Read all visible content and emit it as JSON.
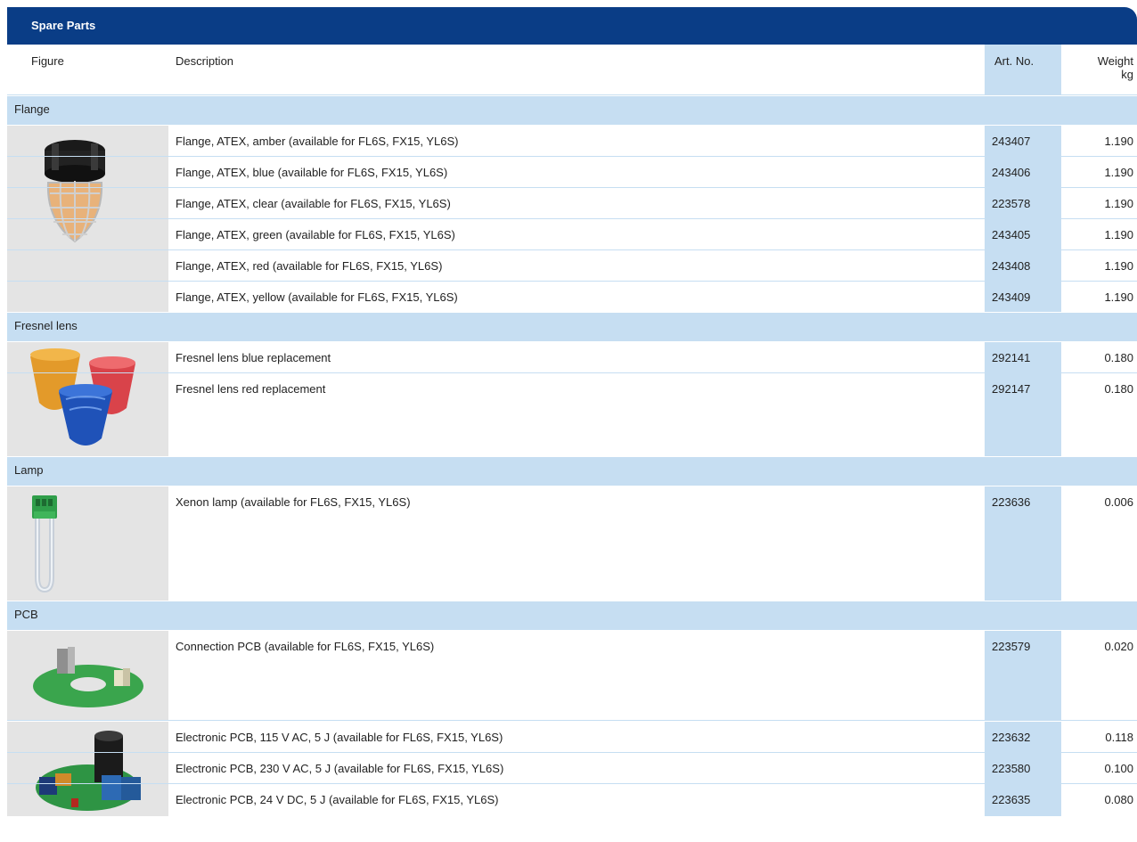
{
  "title": "Spare Parts",
  "headers": {
    "figure": "Figure",
    "description": "Description",
    "art_no": "Art. No.",
    "weight_line1": "Weight",
    "weight_line2": "kg"
  },
  "colors": {
    "header_bar": "#0a3d86",
    "light_blue": "#c6def2",
    "figure_bg": "#e4e4e4"
  },
  "sections": [
    {
      "name": "Flange",
      "groups": [
        {
          "icon": "flange-icon",
          "rows": [
            {
              "description": "Flange, ATEX, amber (available for FL6S, FX15, YL6S)",
              "art_no": "243407",
              "weight": "1.190"
            },
            {
              "description": "Flange, ATEX, blue (available for FL6S, FX15, YL6S)",
              "art_no": "243406",
              "weight": "1.190"
            },
            {
              "description": "Flange, ATEX, clear (available for FL6S, FX15, YL6S)",
              "art_no": "223578",
              "weight": "1.190"
            },
            {
              "description": "Flange, ATEX, green (available for FL6S, FX15, YL6S)",
              "art_no": "243405",
              "weight": "1.190"
            },
            {
              "description": "Flange, ATEX, red (available for FL6S, FX15, YL6S)",
              "art_no": "243408",
              "weight": "1.190"
            },
            {
              "description": "Flange, ATEX, yellow (available for FL6S, FX15, YL6S)",
              "art_no": "243409",
              "weight": "1.190"
            }
          ]
        }
      ]
    },
    {
      "name": "Fresnel lens",
      "groups": [
        {
          "icon": "fresnel-lens-icon",
          "rows": [
            {
              "description": "Fresnel lens blue replacement",
              "art_no": "292141",
              "weight": "0.180"
            },
            {
              "description": "Fresnel lens red replacement",
              "art_no": "292147",
              "weight": "0.180"
            }
          ]
        }
      ]
    },
    {
      "name": "Lamp",
      "groups": [
        {
          "icon": "xenon-lamp-icon",
          "rows": [
            {
              "description": "Xenon lamp (available for FL6S, FX15, YL6S)",
              "art_no": "223636",
              "weight": "0.006"
            }
          ]
        }
      ]
    },
    {
      "name": "PCB",
      "groups": [
        {
          "icon": "connection-pcb-icon",
          "rows": [
            {
              "description": "Connection PCB (available for FL6S, FX15, YL6S)",
              "art_no": "223579",
              "weight": "0.020"
            }
          ]
        },
        {
          "icon": "electronic-pcb-icon",
          "rows": [
            {
              "description": "Electronic PCB, 115 V AC, 5 J (available for FL6S, FX15, YL6S)",
              "art_no": "223632",
              "weight": "0.118"
            },
            {
              "description": "Electronic PCB, 230 V AC, 5 J (available for FL6S, FX15, YL6S)",
              "art_no": "223580",
              "weight": "0.100"
            },
            {
              "description": "Electronic PCB, 24 V DC, 5 J (available for FL6S, FX15, YL6S)",
              "art_no": "223635",
              "weight": "0.080"
            }
          ]
        }
      ]
    }
  ]
}
